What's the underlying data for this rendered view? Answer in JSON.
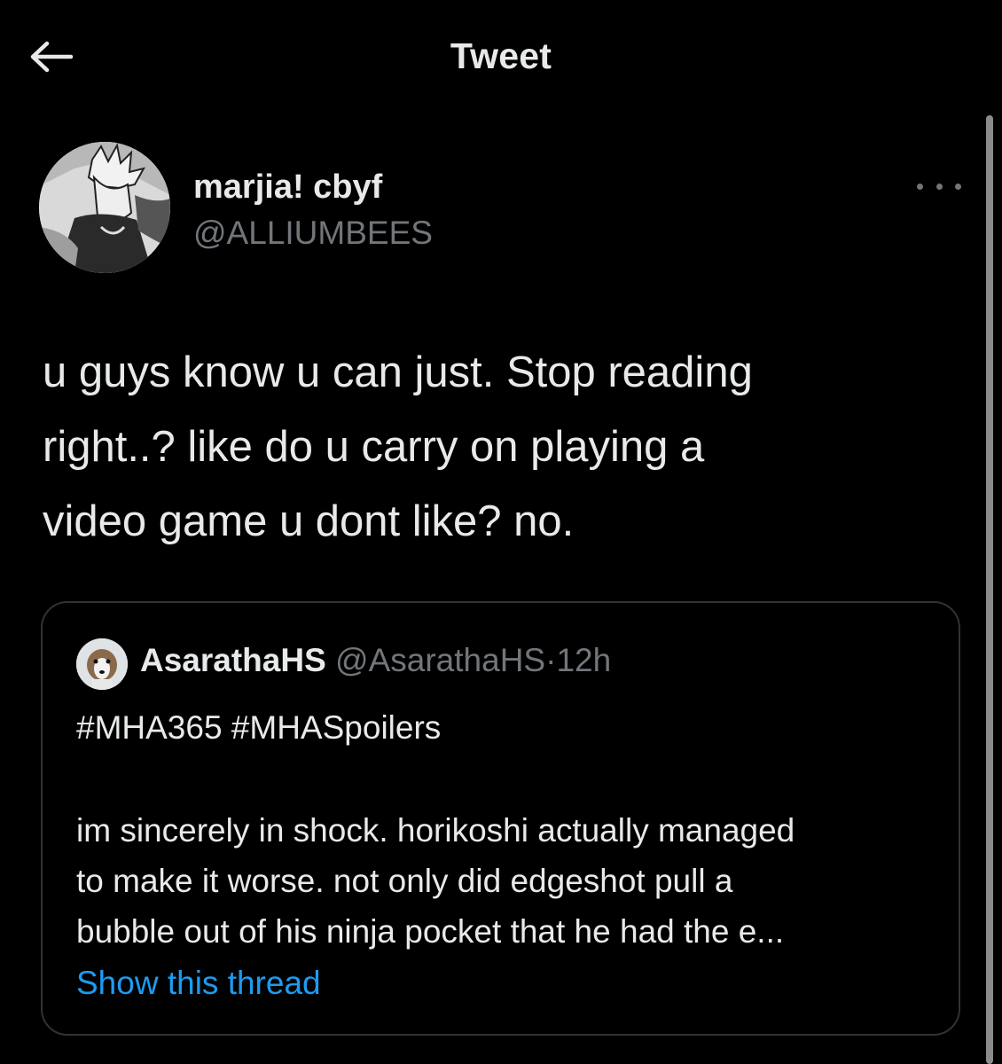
{
  "header": {
    "title": "Tweet",
    "back_icon": "arrow-left-icon"
  },
  "tweet": {
    "author": {
      "display_name": "marjia! cbyf",
      "handle": "@ALLIUMBEES"
    },
    "more_icon": "more-horizontal-icon",
    "text": "u guys know u can just. Stop reading\nright..? like do u carry on playing a\nvideo game u dont like? no."
  },
  "quote": {
    "display_name": "AsarathaHS",
    "handle": "@AsarathaHS",
    "separator": "·",
    "time": "12h",
    "hashtags": "#MHA365 #MHASpoilers",
    "body": "im sincerely in shock. horikoshi actually managed\nto make it worse. not only did edgeshot pull a\nbubble out of his ninja pocket that he had the e...",
    "show_thread": "Show this thread"
  },
  "colors": {
    "background": "#000000",
    "text": "#e7e9ea",
    "secondary": "#71767b",
    "link": "#1d9bf0",
    "border": "#2f3336"
  }
}
